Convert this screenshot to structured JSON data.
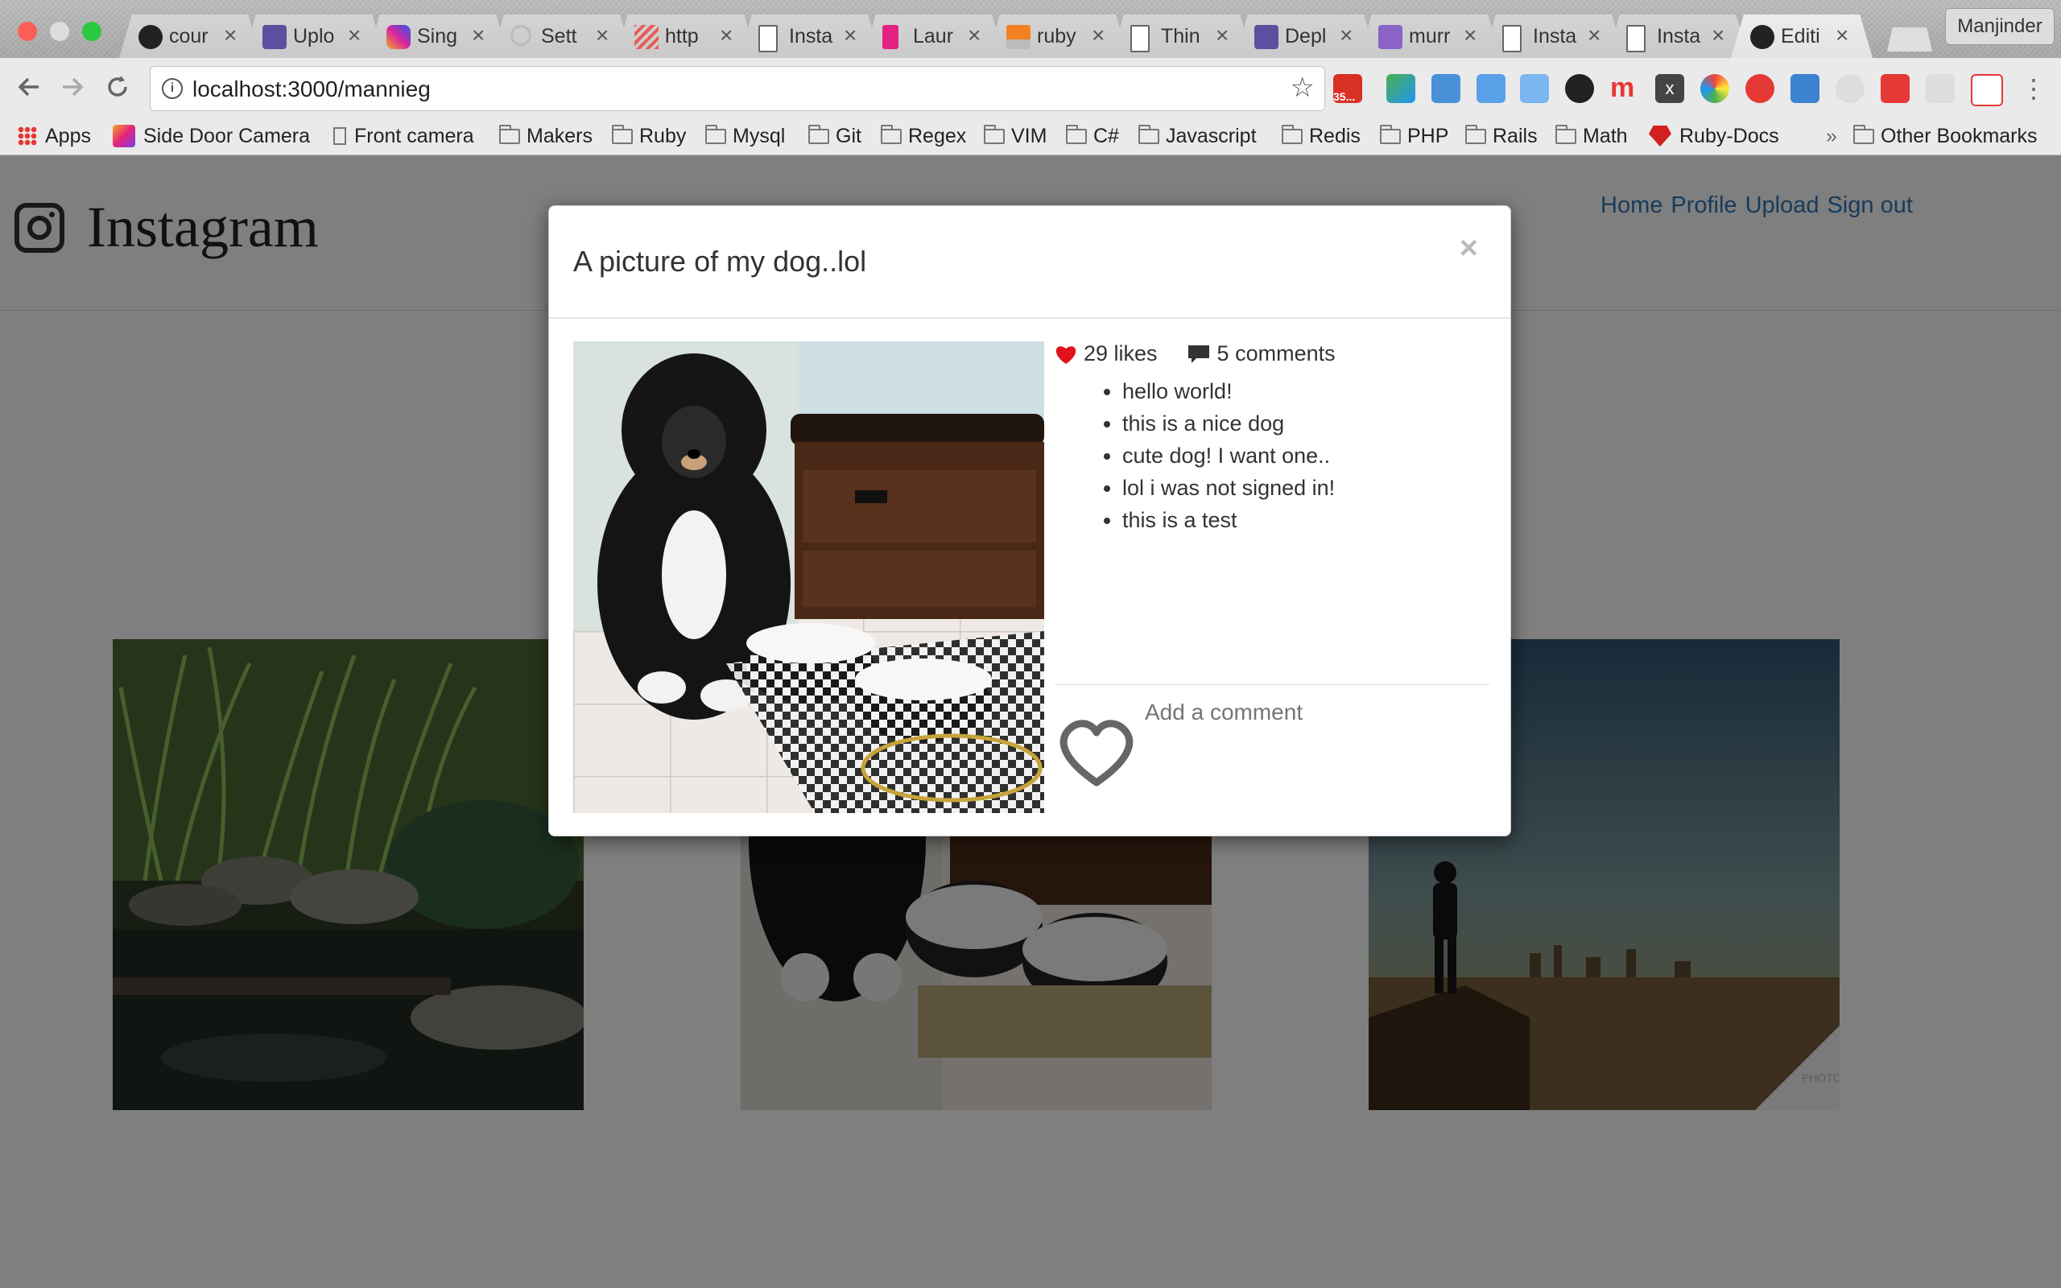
{
  "browser": {
    "tabs": [
      {
        "title": "cour",
        "icon": "github-icon"
      },
      {
        "title": "Uplo",
        "icon": "heroku-icon"
      },
      {
        "title": "Sing",
        "icon": "instagram-icon"
      },
      {
        "title": "Sett",
        "icon": "loading-icon"
      },
      {
        "title": "http",
        "icon": "stripes-icon"
      },
      {
        "title": "Insta",
        "icon": "page-icon"
      },
      {
        "title": "Laur",
        "icon": "laurel-icon"
      },
      {
        "title": "ruby",
        "icon": "stackoverflow-icon"
      },
      {
        "title": "Thin",
        "icon": "page-icon"
      },
      {
        "title": "Depl",
        "icon": "heroku-icon"
      },
      {
        "title": "murr",
        "icon": "heroku-icon"
      },
      {
        "title": "Insta",
        "icon": "page-icon"
      },
      {
        "title": "Insta",
        "icon": "page-icon"
      },
      {
        "title": "Editi",
        "icon": "github-icon"
      }
    ],
    "profile_name": "Manjinder",
    "url": "localhost:3000/mannieg",
    "gmail_badge": "35...",
    "bookmarks": [
      {
        "label": "Apps",
        "type": "apps"
      },
      {
        "label": "Side Door Camera",
        "type": "logo"
      },
      {
        "label": "Front camera",
        "type": "page"
      },
      {
        "label": "Makers",
        "type": "folder"
      },
      {
        "label": "Ruby",
        "type": "folder"
      },
      {
        "label": "Mysql",
        "type": "folder"
      },
      {
        "label": "Git",
        "type": "folder"
      },
      {
        "label": "Regex",
        "type": "folder"
      },
      {
        "label": "VIM",
        "type": "folder"
      },
      {
        "label": "C#",
        "type": "folder"
      },
      {
        "label": "Javascript",
        "type": "folder"
      },
      {
        "label": "Redis",
        "type": "folder"
      },
      {
        "label": "PHP",
        "type": "folder"
      },
      {
        "label": "Rails",
        "type": "folder"
      },
      {
        "label": "Math",
        "type": "folder"
      },
      {
        "label": "Ruby-Docs",
        "type": "logo"
      }
    ],
    "overflow_label": "»",
    "other_bookmarks": "Other Bookmarks"
  },
  "site": {
    "logo_text": "Instagram",
    "nav": [
      "Home",
      "Profile",
      "Upload",
      "Sign out"
    ]
  },
  "modal": {
    "title": "A picture of my dog..lol",
    "close_symbol": "×",
    "likes": "29 likes",
    "comments_count": "5 comments",
    "comments": [
      "hello world!",
      "this is a nice dog",
      "cute dog! I want one..",
      "lol i was not signed in!",
      "this is a test"
    ],
    "add_comment_placeholder": "Add a comment"
  },
  "grid": {
    "photos": [
      "garden-pond-photo",
      "dog-photo",
      "city-view-photo"
    ],
    "watermark": "PHOTO OF THE DAY"
  },
  "colors": {
    "link": "#3177b7",
    "heart_red": "#e0131c",
    "overlay": "rgba(0,0,0,0.5)"
  }
}
